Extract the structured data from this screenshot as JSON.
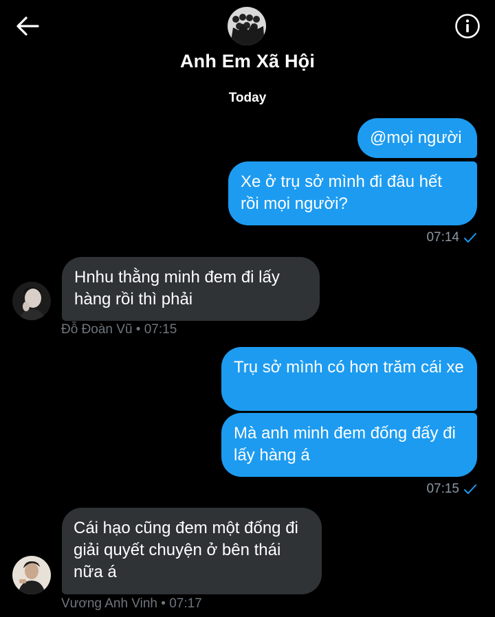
{
  "header": {
    "back_icon": "arrow-left-icon",
    "info_icon": "info-circle-icon",
    "group_name": "Anh Em Xã Hội"
  },
  "conversation": {
    "day_label": "Today",
    "messages": [
      {
        "direction": "outgoing",
        "text": "@mọi người"
      },
      {
        "direction": "outgoing",
        "text": "Xe ở trụ sở mình đi đâu hết rồi mọi người?"
      },
      {
        "direction": "outgoing_meta",
        "time": "07:14",
        "status_icon": "sent-check-icon"
      },
      {
        "direction": "incoming",
        "text": "Hnhu thằng minh đem đi lấy hàng rồi thì phải",
        "sender": "Đỗ Đoàn Vũ",
        "time": "07:15",
        "meta": "Đỗ Đoàn Vũ • 07:15"
      },
      {
        "direction": "outgoing",
        "text": "Trụ sở mình có hơn trăm cái xe"
      },
      {
        "direction": "outgoing",
        "text": "Mà anh minh đem đống đấy đi lấy hàng á"
      },
      {
        "direction": "outgoing_meta",
        "time": "07:15",
        "status_icon": "sent-check-icon"
      },
      {
        "direction": "incoming",
        "text": "Cái hạo cũng đem một đống đi giải quyết chuyện ở bên thái nữa á",
        "sender": "Vương Anh Vinh",
        "time": "07:17",
        "meta": "Vương Anh Vinh • 07:17"
      }
    ]
  },
  "colors": {
    "background": "#000000",
    "outgoing_bubble": "#1d9bf0",
    "incoming_bubble": "#2f3336",
    "meta_text": "#8b98a5",
    "check": "#1d9bf0"
  }
}
